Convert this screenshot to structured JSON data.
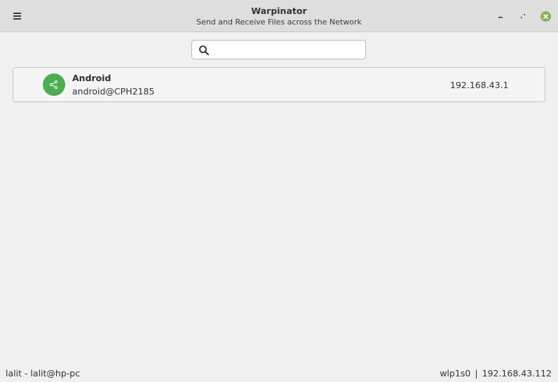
{
  "window": {
    "title": "Warpinator",
    "subtitle": "Send and Receive Files across the Network"
  },
  "search": {
    "value": "",
    "placeholder": ""
  },
  "devices": [
    {
      "name": "Android",
      "user_host": "android@CPH2185",
      "ip": "192.168.43.1"
    }
  ],
  "statusbar": {
    "user": "lalit - lalit@hp-pc",
    "interface": "wlp1s0",
    "separator": "|",
    "ip": "192.168.43.112"
  },
  "colors": {
    "avatar": "#4cae4f",
    "close_button": "#8bb158",
    "titlebar": "#dedede",
    "background": "#f0f0f0"
  },
  "icons": {
    "menu": "hamburger-menu-icon",
    "minimize": "minimize-icon",
    "maximize": "maximize-icon",
    "close": "close-icon",
    "search": "search-icon",
    "device": "share-network-icon"
  }
}
